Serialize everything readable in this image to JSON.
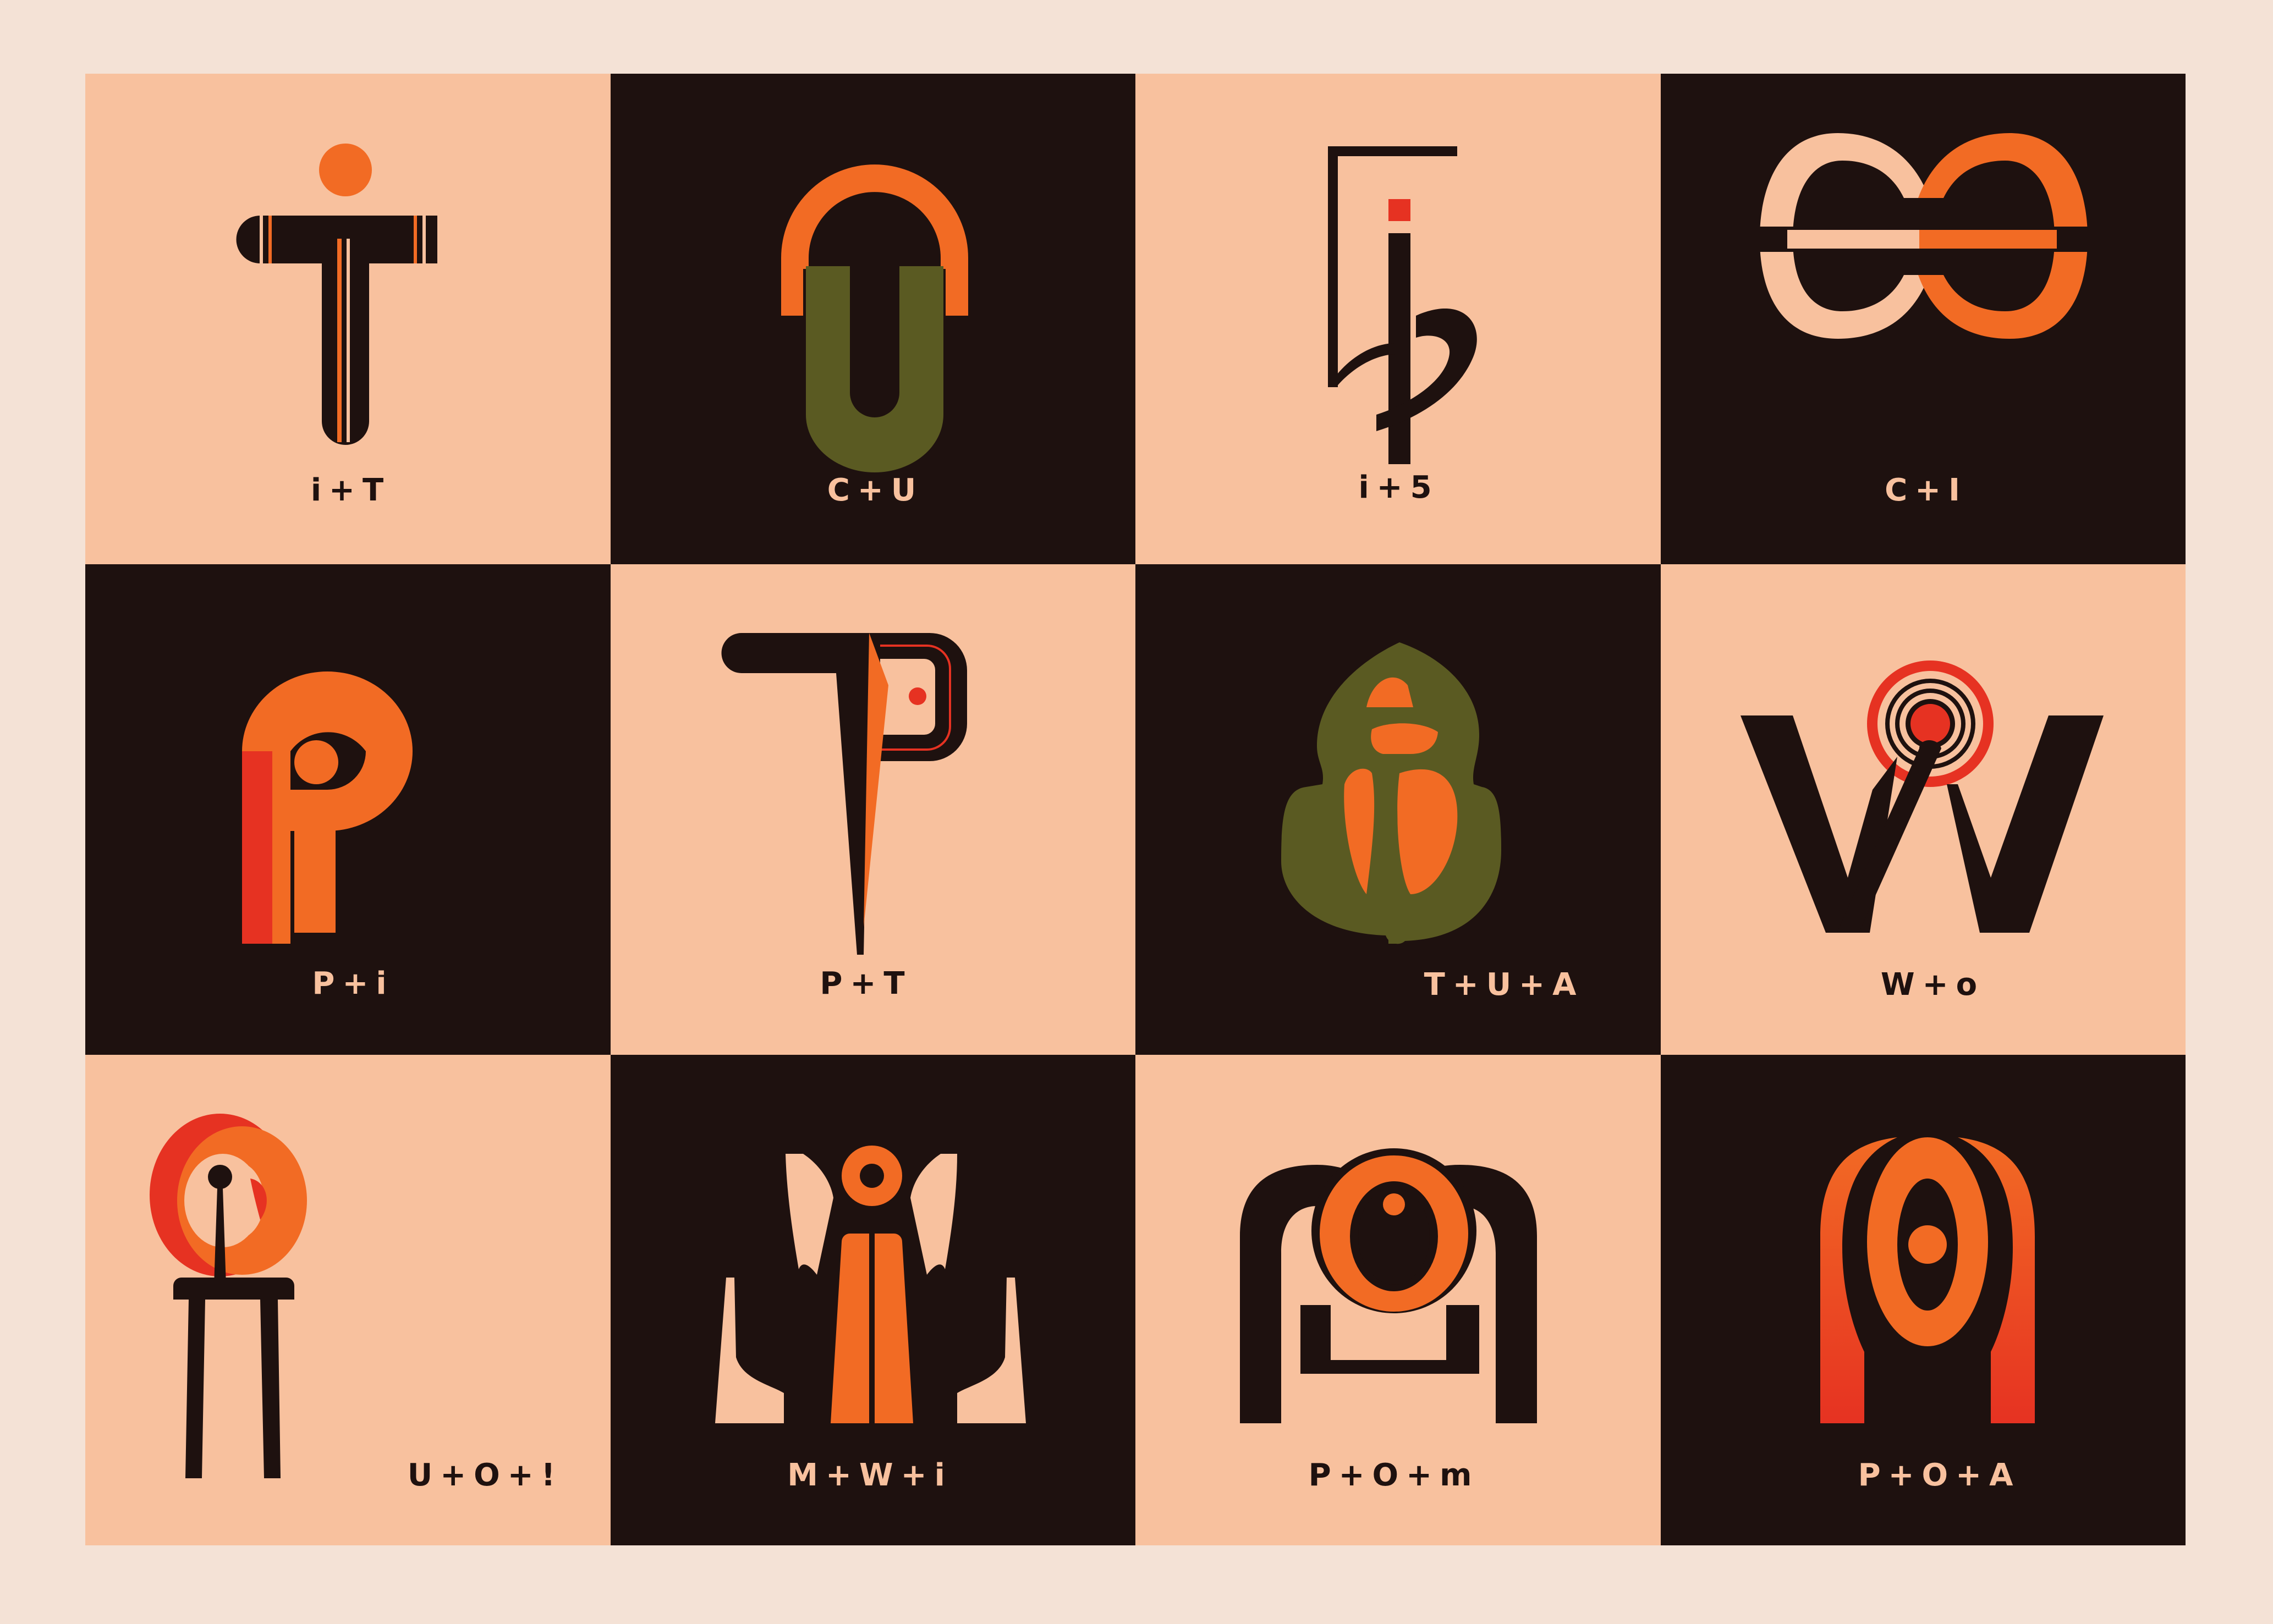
{
  "colors": {
    "background": "#f4e2d6",
    "peach": "#f8c19e",
    "dark": "#1e110f",
    "orange": "#f26b24",
    "red": "#e63222",
    "olive": "#5a5a22"
  },
  "tiles": [
    {
      "caption": "i+T",
      "theme": "light",
      "icon": "i-plus-t-glyph"
    },
    {
      "caption": "C+U",
      "theme": "dark",
      "icon": "c-plus-u-glyph"
    },
    {
      "caption": "i+5",
      "theme": "light",
      "icon": "i-plus-5-glyph"
    },
    {
      "caption": "C+I",
      "theme": "dark",
      "icon": "c-plus-i-glyph"
    },
    {
      "caption": "P+i",
      "theme": "dark",
      "icon": "p-plus-i-glyph"
    },
    {
      "caption": "P+T",
      "theme": "light",
      "icon": "p-plus-t-glyph"
    },
    {
      "caption": "T+U+A",
      "theme": "dark",
      "icon": "t-plus-u-plus-a-glyph"
    },
    {
      "caption": "W+o",
      "theme": "light",
      "icon": "w-plus-o-glyph"
    },
    {
      "caption": "U+O+!",
      "theme": "light",
      "icon": "u-plus-o-plus-exclamation-glyph"
    },
    {
      "caption": "M+W+i",
      "theme": "dark",
      "icon": "m-plus-w-plus-i-glyph"
    },
    {
      "caption": "P+O+m",
      "theme": "light",
      "icon": "p-plus-o-plus-m-glyph"
    },
    {
      "caption": "P+O+A",
      "theme": "dark",
      "icon": "p-plus-o-plus-a-glyph"
    }
  ]
}
